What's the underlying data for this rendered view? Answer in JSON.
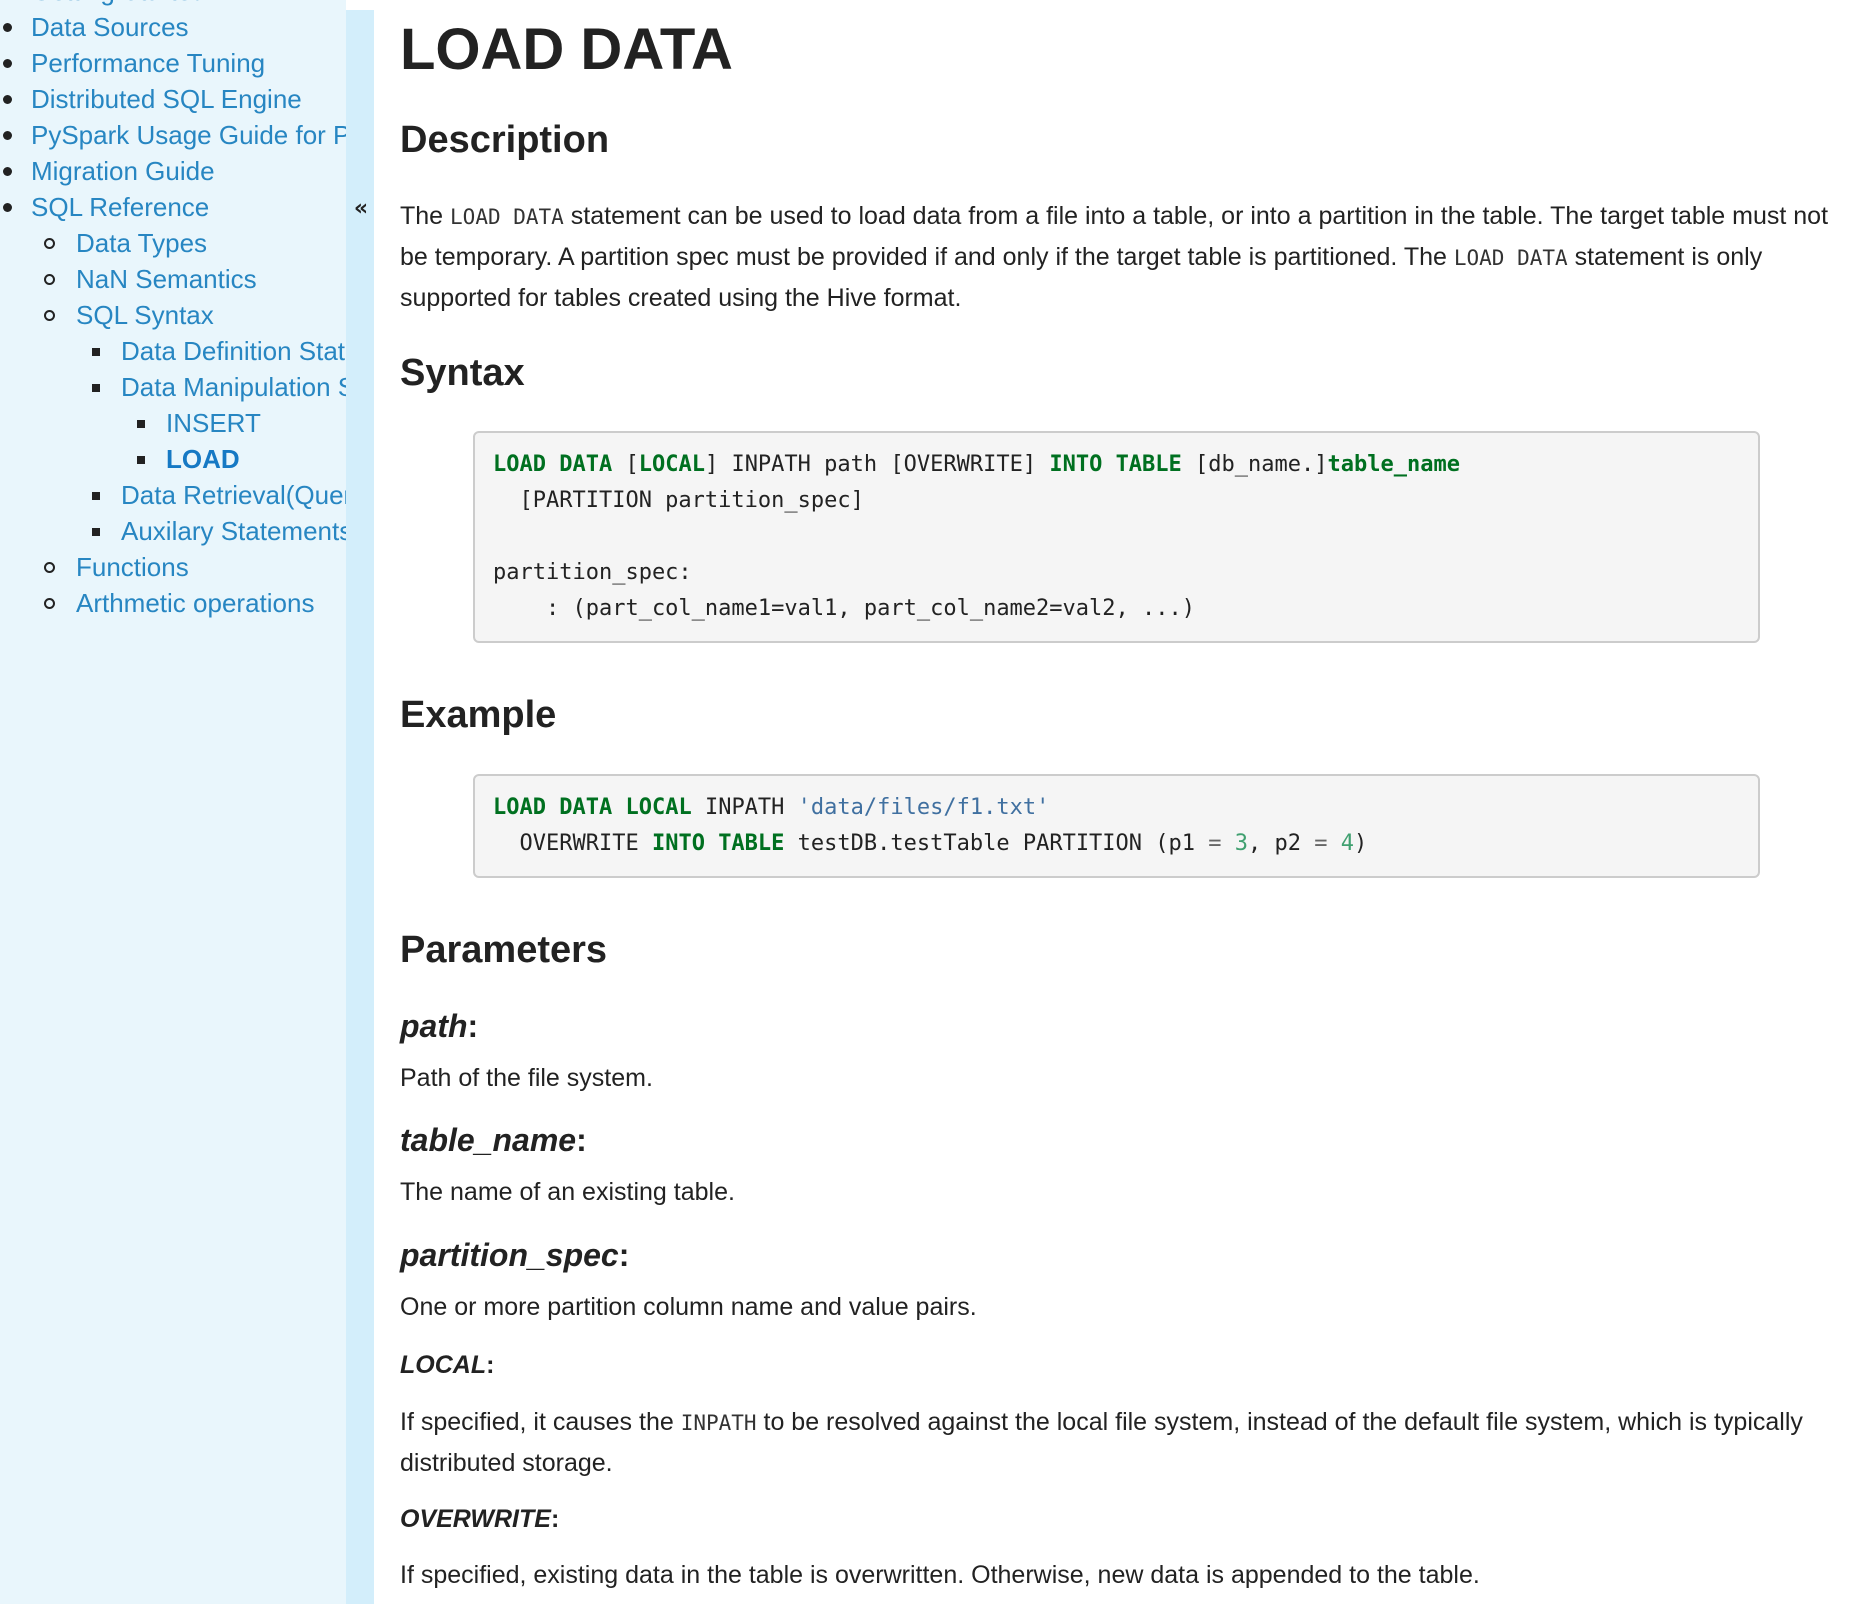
{
  "sidebar": {
    "collapse_glyph": "«",
    "items": [
      {
        "label": "Getting Started"
      },
      {
        "label": "Data Sources"
      },
      {
        "label": "Performance Tuning"
      },
      {
        "label": "Distributed SQL Engine"
      },
      {
        "label": "PySpark Usage Guide for Pandas with Apache Arrow"
      },
      {
        "label": "Migration Guide"
      },
      {
        "label": "SQL Reference",
        "children": [
          {
            "label": "Data Types"
          },
          {
            "label": "NaN Semantics"
          },
          {
            "label": "SQL Syntax",
            "children": [
              {
                "label": "Data Definition Statements"
              },
              {
                "label": "Data Manipulation Statements",
                "children": [
                  {
                    "label": "INSERT"
                  },
                  {
                    "label": "LOAD",
                    "active": true
                  }
                ]
              },
              {
                "label": "Data Retrieval(Queries)"
              },
              {
                "label": "Auxilary Statements"
              }
            ]
          },
          {
            "label": "Functions"
          },
          {
            "label": "Arthmetic operations"
          }
        ]
      }
    ]
  },
  "page": {
    "title": "LOAD DATA",
    "description": {
      "heading": "Description",
      "text_1": "The ",
      "code_1": "LOAD DATA",
      "text_2": " statement can be used to load data from a file into a table, or into a partition in the table. The target table must not be temporary. A partition spec must be provided if and only if the target table is partitioned. The ",
      "code_2": "LOAD DATA",
      "text_3": " statement is only supported for tables created using the Hive format."
    },
    "syntax": {
      "heading": "Syntax",
      "t1": "LOAD",
      "t2": " ",
      "t3": "DATA",
      "t4": " [",
      "t5": "LOCAL",
      "t6": "] INPATH path [OVERWRITE] ",
      "t7": "INTO",
      "t8": " ",
      "t9": "TABLE",
      "t10": " [db_name.]",
      "t11": "table_name",
      "line2": "  [PARTITION partition_spec]",
      "line4": "partition_spec:",
      "line5": "    : (part_col_name1=val1, part_col_name2=val2, ...)"
    },
    "example": {
      "heading": "Example",
      "t1": "LOAD",
      "t2": " ",
      "t3": "DATA",
      "t4": " ",
      "t5": "LOCAL",
      "t6": " INPATH ",
      "t7": "'data/files/f1.txt'",
      "l2a": "  OVERWRITE ",
      "l2b": "INTO",
      "l2c": " ",
      "l2d": "TABLE",
      "l2e": " testDB.testTable PARTITION (p1 ",
      "l2f": "=",
      "l2g": " ",
      "l2h": "3",
      "l2i": ", p2 ",
      "l2j": "=",
      "l2k": " ",
      "l2l": "4",
      "l2m": ")"
    },
    "parameters": {
      "heading": "Parameters",
      "path": {
        "name": "path",
        "colon": ":",
        "text": "Path of the file system."
      },
      "table_name": {
        "name": "table_name",
        "colon": ":",
        "text": "The name of an existing table."
      },
      "partition_spec": {
        "name": "partition_spec",
        "colon": ":",
        "text": "One or more partition column name and value pairs."
      },
      "local": {
        "name": "LOCAL",
        "colon": ":",
        "text_1": "If specified, it causes the ",
        "code": "INPATH",
        "text_2": " to be resolved against the local file system, instead of the default file system, which is typically distributed storage."
      },
      "overwrite": {
        "name": "OVERWRITE",
        "colon": ":",
        "text": "If specified, existing data in the table is overwritten. Otherwise, new data is appended to the table."
      }
    }
  }
}
